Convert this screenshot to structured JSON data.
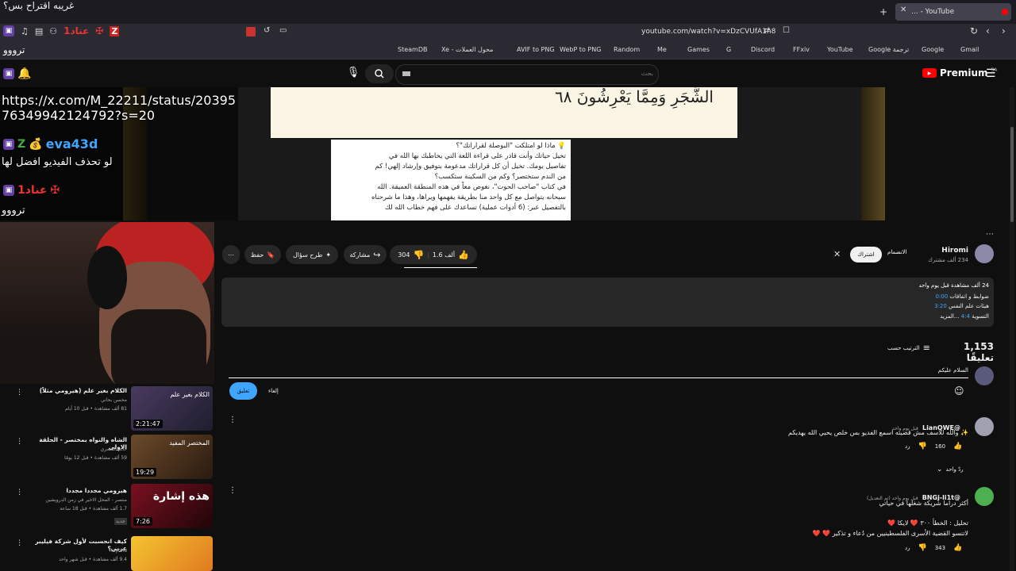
{
  "overlay": {
    "top_message": "غريبه اقتراح بس؟",
    "line1": "ترووو",
    "user_badge_text": "عناد1",
    "url_message": "https://x.com/M_22211/status/20395",
    "url_message2": "7634994212479​2?s=20",
    "user2": "eva43d",
    "msg2": "لو تحذف الفيديو افضل لها",
    "user3": "عناد1",
    "msg3": "ترووو",
    "mini_badge": "Z"
  },
  "browser": {
    "tab_title": "... - YouTube",
    "url": "youtube.com/watch?v=xDzCVUfA1n8",
    "bookmarks": [
      "SteamDB",
      "Xe - محول العملات",
      "AVIF to PNG",
      "WebP to PNG",
      "Random",
      "Me",
      "Games",
      "G",
      "Discord",
      "FFxiv",
      "YouTube",
      "Google ترجمة",
      "Google",
      "Gmail"
    ],
    "new_tab_label": "+"
  },
  "youtube": {
    "brand": "Premium",
    "region": "SA",
    "search_placeholder": "بحث",
    "video_overlay_text": "الشَّجَرِ وَمِمَّا يَعْرِشُونَ ٦٨",
    "video_desc": [
      "💡 ماذا لو امتلكت \"البوصلة لقراراتك\"؟",
      "تخيل حياتك وأنت قادر على قراءة اللغة التي يخاطبك بها الله في",
      "تفاصيل يومك. تخيل أن كل قراراتك مدعومة بتوفيق وإرشاد إلهي! كم",
      "من الندم ستختصر؟ وكم من السكينة ستكسب؟",
      "في كتاب \"صاحب الحوت\"، نغوص معاً في هذه المنطقة العميقة. الله",
      "سبحانه يتواصل مع كل واحد منا بطريقة يفهمها ويراها، وهذا ما شرحناه",
      "بالتفصيل عبر: (6 أدوات عملية) تساعدك على فهم خطاب الله لك"
    ],
    "channel": {
      "name": "Hiromi",
      "subs": "234 ألف مشترك",
      "join_label": "الانضمام",
      "subscribe_label": "اشتراك"
    },
    "actions": {
      "likes": "1.6 ألف",
      "dislikes": "304",
      "share": "مشاركة",
      "ask": "طرح سؤال",
      "save": "حفظ"
    },
    "description_box": {
      "line1": "24 ألف مشاهدة  قبل يوم واحد",
      "line2a": "ضوابط و اتفاقات",
      "line2b": "0:00",
      "line3a": "هيئات علم النفس",
      "line3b": "3:20",
      "line4a": "التسوية",
      "line4b": "4:4",
      "line4c": "...المزيد"
    },
    "comments": {
      "count": "1,153 تعليقًا",
      "sort_label": "الترتيب حسب",
      "input_value": "السلام عليكم",
      "cancel_label": "إلغاء",
      "submit_label": "تعليق",
      "items": [
        {
          "user": "@LianQWE",
          "time": "قبل يوم واحد",
          "text": "✨ والله للاسف مش قضيته اسمع الفديو بس خلص يحيي الله يهديكم",
          "likes": "160",
          "reply": "رد",
          "replies": "ردّ واحد"
        },
        {
          "user": "@BNGj-li1t",
          "time": "قبل يوم واحد (تم التعديل)",
          "text": "أكثر دراما شريكة شغلها في حياتي",
          "text2": "تحليل : الخطأ ٣٠٠ ❤️ لايكا ❤️",
          "text3": "لاتنسو القضية الأسرى الفلسطينيين من دُعاء و تذكير ❤️ ❤️",
          "likes": "343",
          "reply": "رد"
        }
      ]
    },
    "sidebar": [
      {
        "title": "الكلام بغير علم (هيرومي مثلاً)",
        "channel": "محسن بحاني",
        "meta": "81 ألف مشاهدة • قبل 10 أيام",
        "duration": "2:21:47",
        "thumb_text": "الكلام بغير علم"
      },
      {
        "title": "الشاه والنواه بمختصر - الحلقة الاولى",
        "channel": "حاتم الشمري",
        "meta": "59 ألف مشاهدة • قبل 12 يومًا",
        "duration": "19:29",
        "thumb_text": "المختصر المفيد"
      },
      {
        "title": "هيرومي مجددا مجددا",
        "channel": "منتصر - المحل الاخير في زمن الدرويشين",
        "meta": "1.7 ألف مشاهدة • قبل 18 ساعة",
        "duration": "7:26",
        "thumb_text": "هذه إشارة",
        "badge": "جديد"
      },
      {
        "title": "كيف انحسبت لأول شركة فيليبر عربي؟",
        "channel": "Rayona",
        "meta": "9.4 ألف مشاهدة • قبل شهر واحد",
        "duration": "",
        "thumb_text": ""
      }
    ],
    "colors": {
      "accent": "#3ea6ff",
      "brand_red": "#ff0000",
      "twitch": "#6441a5"
    }
  }
}
